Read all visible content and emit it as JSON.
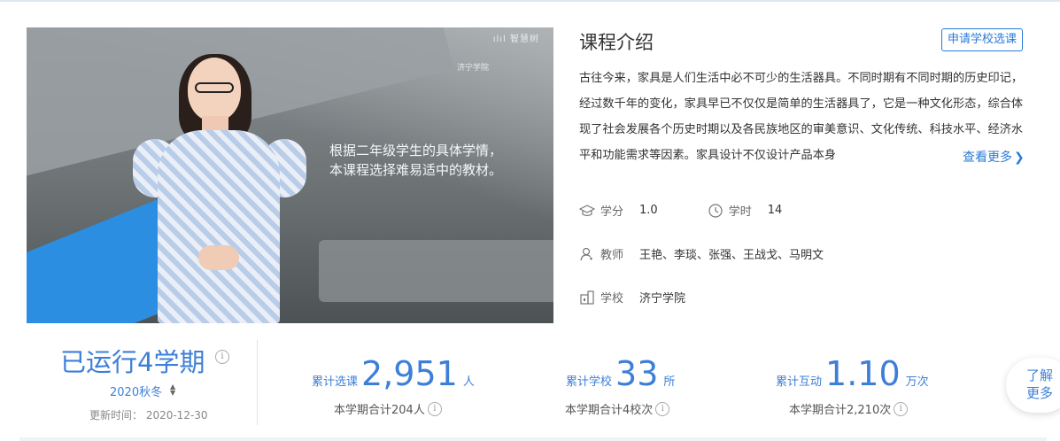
{
  "video": {
    "subtitle_line1": "根据二年级学生的具体学情，",
    "subtitle_line2": "本课程选择难易适中的教材。",
    "watermark_top": "ılıl 智慧树",
    "watermark_logo": "济宁学院"
  },
  "intro": {
    "title": "课程介绍",
    "apply_button": "申请学校选课",
    "description": "古往今来，家具是人们生活中必不可少的生活器具。不同时期有不同时期的历史印记，经过数千年的变化，家具早已不仅仅是简单的生活器具了，它是一种文化形态，综合体现了社会发展各个历史时期以及各民族地区的审美意识、文化传统、科技水平、经济水平和功能需求等因素。家具设计不仅设计产品本身",
    "more_label": "查看更多",
    "credit_label": "学分",
    "credit_value": "1.0",
    "hours_label": "学时",
    "hours_value": "14",
    "teacher_label": "教师",
    "teacher_value": "王艳、李琰、张强、王战戈、马明文",
    "school_label": "学校",
    "school_value": "济宁学院"
  },
  "stats": {
    "running": "已运行4学期",
    "term": "2020秋冬",
    "updated": "更新时间： 2020-12-30",
    "enroll_caption": "累计选课",
    "enroll_value": "2,951",
    "enroll_unit": "人",
    "enroll_sub": "本学期合计204人",
    "schools_caption": "累计学校",
    "schools_value": "33",
    "schools_unit": "所",
    "schools_sub": "本学期合计4校次",
    "interact_caption": "累计互动",
    "interact_value": "1.10",
    "interact_unit": "万次",
    "interact_sub": "本学期合计2,210次",
    "learn_more": "了解更多"
  },
  "colors": {
    "accent": "#3d7fd8",
    "link": "#2a7bd6"
  }
}
